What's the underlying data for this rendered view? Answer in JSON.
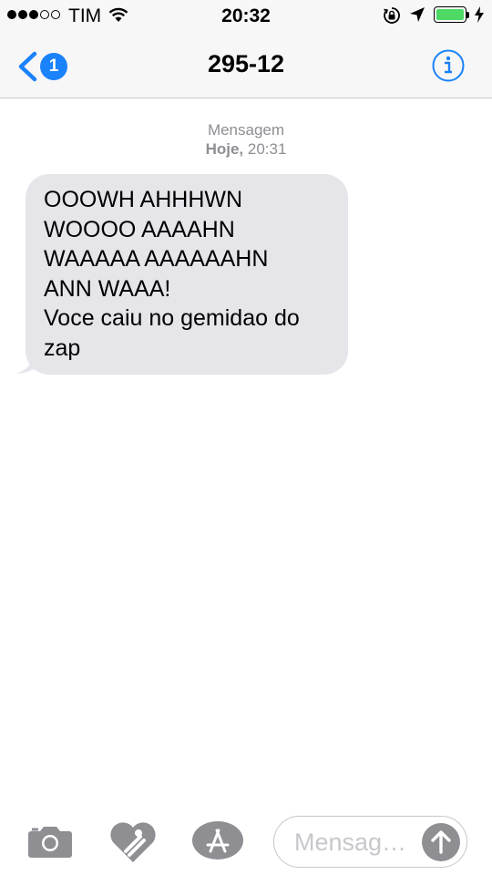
{
  "status_bar": {
    "signal_full_dots": 3,
    "signal_empty_dots": 2,
    "carrier": "TIM",
    "time": "20:32",
    "battery_level": 1.0,
    "battery_color": "#4cd964"
  },
  "nav": {
    "back_badge": "1",
    "title": "295-12",
    "accent_color": "#1a82fb"
  },
  "conversation": {
    "service": "Mensagem",
    "date_bold": "Hoje,",
    "date_time": " 20:31",
    "message_text": "OOOWH AHHHWN\nWOOOO AAAAHN\nWAAAAA AAAAAAHN\nANN WAAA!\nVoce caiu no gemidao do\nzap"
  },
  "compose": {
    "placeholder": "Mensag…",
    "icons": [
      "camera-icon",
      "digital-touch-heart-icon",
      "app-store-icon",
      "send-arrow-icon"
    ]
  }
}
